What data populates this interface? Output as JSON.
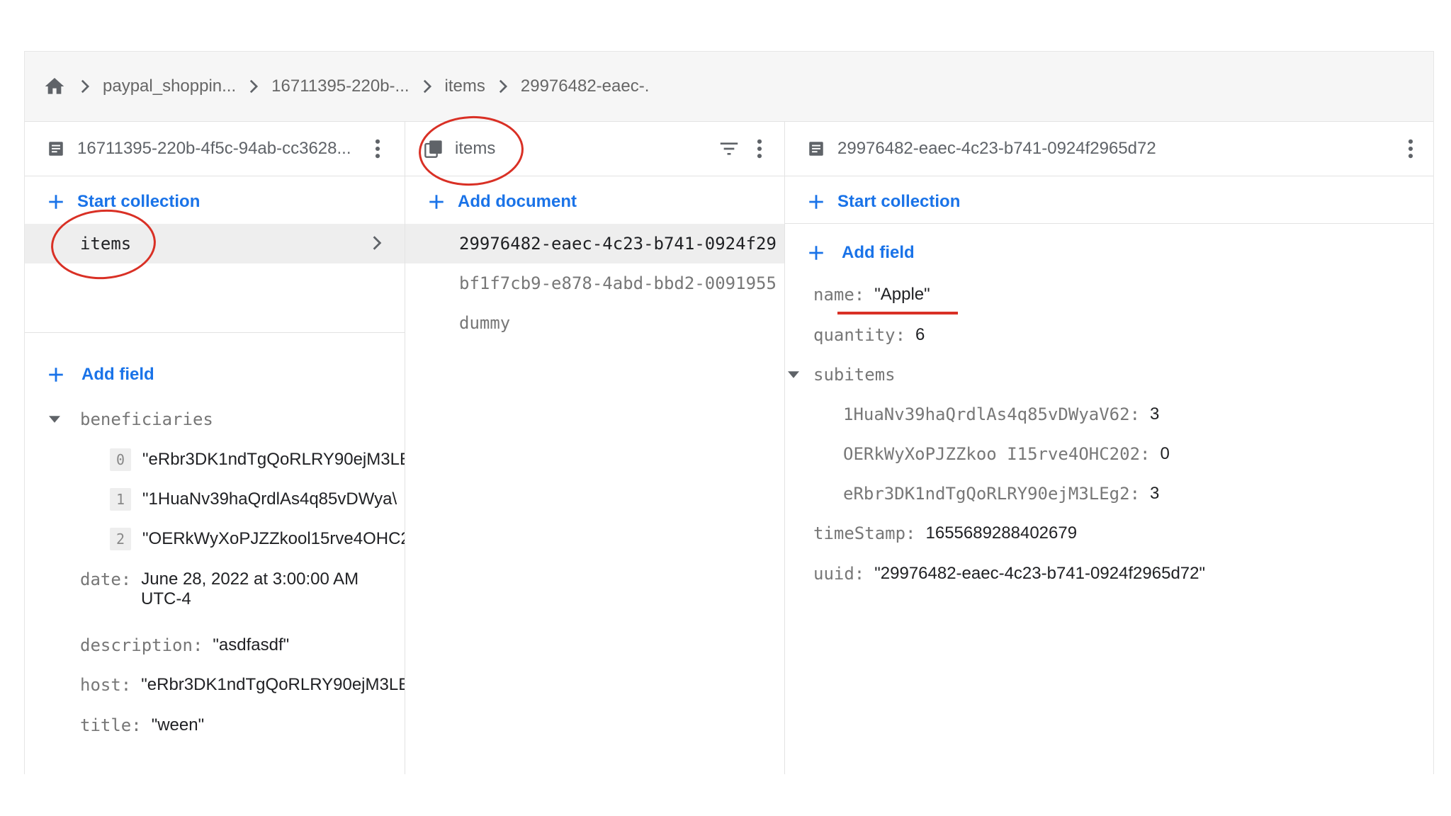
{
  "breadcrumb": {
    "home_icon": "home-icon",
    "items": [
      "paypal_shoppin...",
      "16711395-220b-...",
      "items",
      "29976482-eaec-."
    ]
  },
  "col1": {
    "title": "16711395-220b-4f5c-94ab-cc3628...",
    "start_collection": "Start collection",
    "collection_item": "items",
    "add_field": "Add field",
    "beneficiaries_key": "beneficiaries",
    "beneficiaries": [
      {
        "index": "0",
        "value": "\"eRbr3DK1ndTgQoRLRY90ejM3LE"
      },
      {
        "index": "1",
        "value": "\"1HuaNv39haQrdlAs4q85vDWya\\"
      },
      {
        "index": "2",
        "value": "\"OERkWyXoPJZZkool15rve4OHC2"
      }
    ],
    "date_key": "date:",
    "date_value_line1": "June 28, 2022 at 3:00:00 AM",
    "date_value_line2": "UTC-4",
    "description_key": "description:",
    "description_value": "\"asdfasdf\"",
    "host_key": "host:",
    "host_value": "\"eRbr3DK1ndTgQoRLRY90ejM3LE",
    "title_key": "title:",
    "title_value": "\"ween\""
  },
  "col2": {
    "title": "items",
    "add_document": "Add document",
    "documents": [
      "29976482-eaec-4c23-b741-0924f29",
      "bf1f7cb9-e878-4abd-bbd2-0091955",
      "dummy"
    ]
  },
  "col3": {
    "title": "29976482-eaec-4c23-b741-0924f2965d72",
    "start_collection": "Start collection",
    "add_field": "Add field",
    "name_key": "name:",
    "name_value": "\"Apple\"",
    "quantity_key": "quantity:",
    "quantity_value": "6",
    "subitems_key": "subitems",
    "subitems": [
      {
        "key": "1HuaNv39haQrdlAs4q85vDWyaV62:",
        "value": "3"
      },
      {
        "key": "OERkWyXoPJZZkoo I15rve4OHC202:",
        "value": "0"
      },
      {
        "key": "eRbr3DK1ndTgQoRLRY90ejM3LEg2:",
        "value": "3"
      }
    ],
    "timestamp_key": "timeStamp:",
    "timestamp_value": "1655689288402679",
    "uuid_key": "uuid:",
    "uuid_value": "\"29976482-eaec-4c23-b741-0924f2965d72\""
  },
  "colors": {
    "accent": "#1a73e8",
    "annotation": "#d93025"
  }
}
